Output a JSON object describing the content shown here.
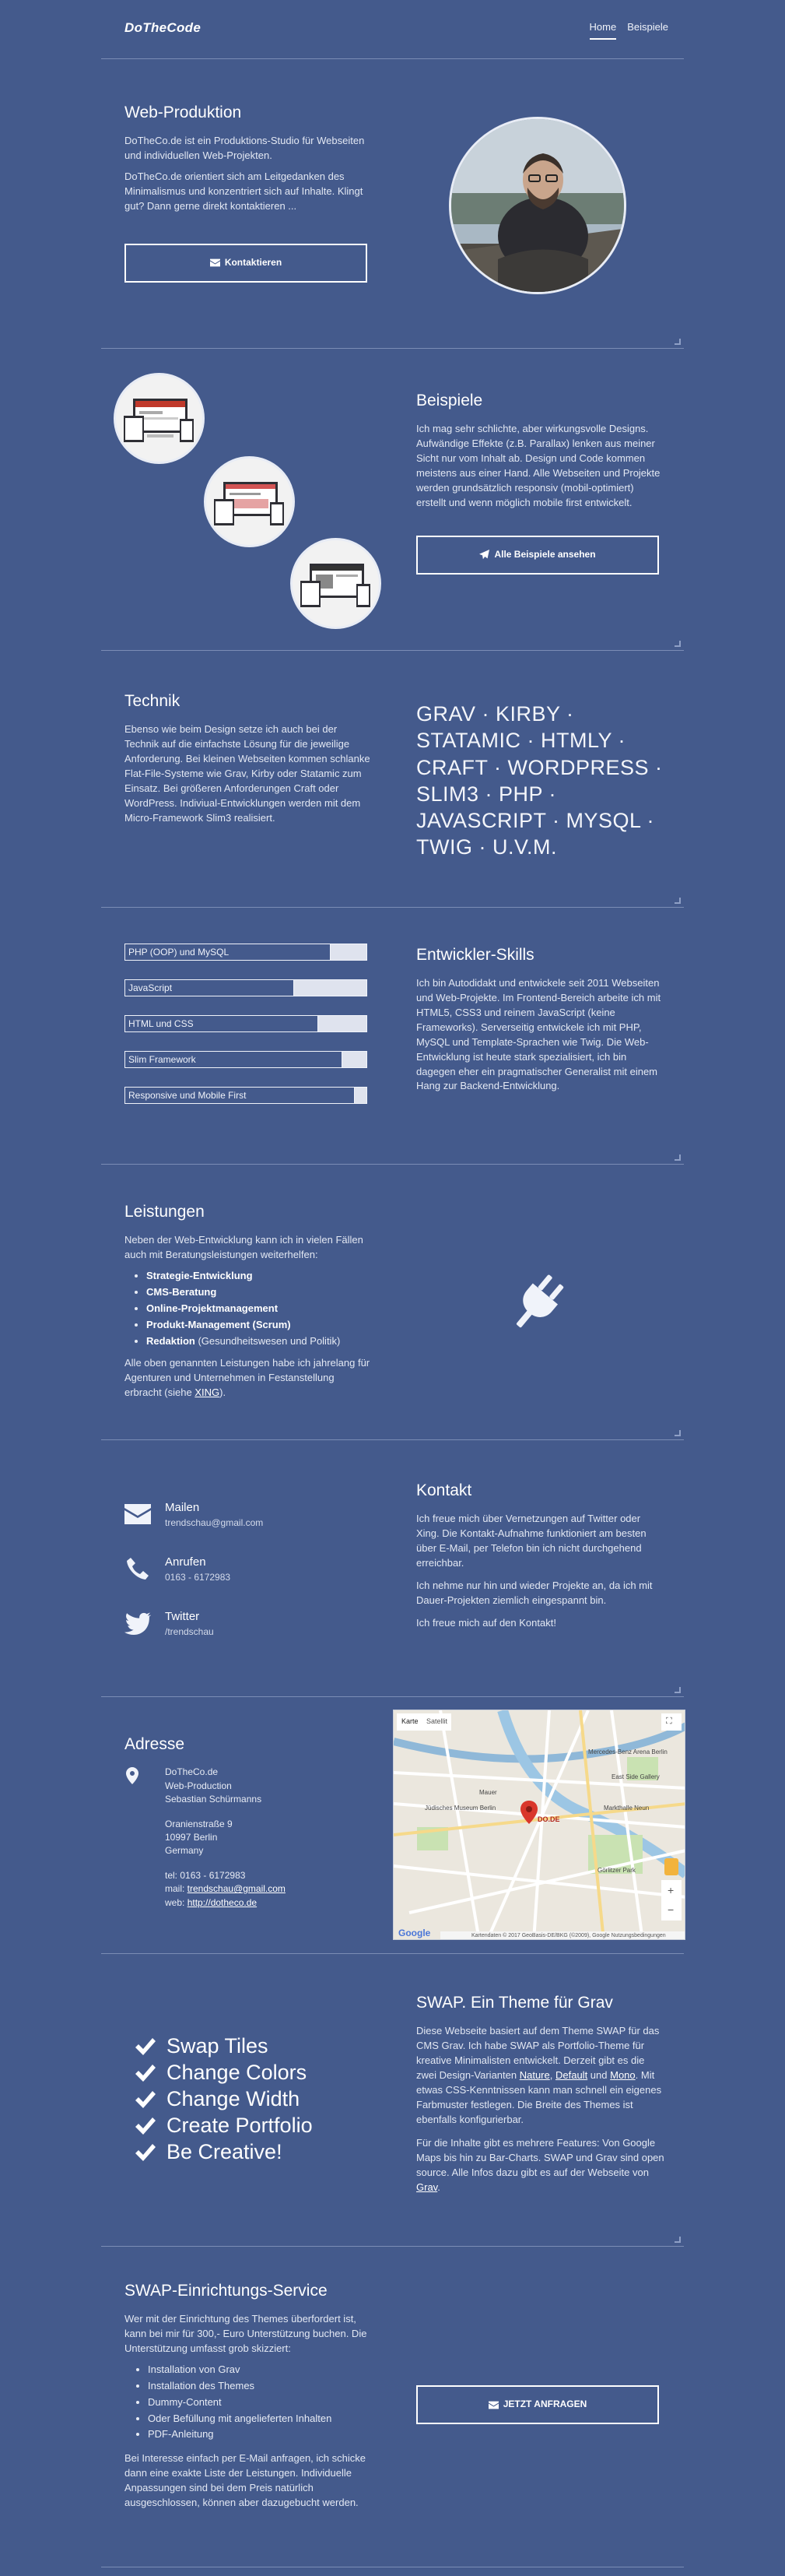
{
  "brand": "DoTheCode",
  "nav": [
    {
      "label": "Home",
      "active": true
    },
    {
      "label": "Beispiele",
      "active": false
    }
  ],
  "webprod": {
    "title": "Web-Produktion",
    "p1": "DoTheCo.de ist ein Produktions-Studio für Webseiten und individuellen Web-Projekten.",
    "p2": "DoTheCo.de orientiert sich am Leitgedanken des Minimalismus und konzentriert sich auf Inhalte. Klingt gut? Dann gerne direkt kontaktieren ...",
    "button": "Kontaktieren"
  },
  "beispiele": {
    "title": "Beispiele",
    "text": "Ich mag sehr schlichte, aber wirkungsvolle Designs. Aufwändige Effekte (z.B. Parallax) lenken aus meiner Sicht nur vom Inhalt ab. Design und Code kommen meistens aus einer Hand. Alle Webseiten und Projekte werden grundsätzlich responsiv (mobil-optimiert) erstellt und wenn möglich mobile first entwickelt.",
    "button": "Alle Beispiele ansehen"
  },
  "technik": {
    "title": "Technik",
    "text": "Ebenso wie beim Design setze ich auch bei der Technik auf die einfachste Lösung für die jeweilige Anforderung. Bei kleinen Webseiten kommen schlanke Flat-File-Systeme wie Grav, Kirby oder Statamic zum Einsatz. Bei größeren Anforderungen Craft oder WordPress. Indiviual-Entwicklungen werden mit dem Micro-Framework Slim3 realisiert.",
    "stack": "GRAV · KIRBY · STATAMIC · HTMLY · CRAFT · WORDPRESS · SLIM3 · PHP · JAVASCRIPT · MYSQL · TWIG · U.V.M."
  },
  "skills": {
    "title": "Entwickler-Skills",
    "text": "Ich bin Autodidakt und entwickele seit 2011 Webseiten und Web-Projekte. Im Frontend-Bereich arbeite ich mit HTML5, CSS3 und reinem JavaScript (keine Frameworks). Serverseitig entwickele ich mit PHP, MySQL und Template-Sprachen wie Twig. Die Web-Entwicklung ist heute stark spezialisiert, ich bin dagegen eher ein pragmatischer Generalist mit einem Hang zur Backend-Entwicklung.",
    "bars": [
      {
        "label": "PHP (OOP) und MySQL",
        "level": 0.85
      },
      {
        "label": "JavaScript",
        "level": 0.7
      },
      {
        "label": "HTML und CSS",
        "level": 0.8
      },
      {
        "label": "Slim Framework",
        "level": 0.9
      },
      {
        "label": "Responsive und Mobile First",
        "level": 0.95
      }
    ]
  },
  "leistungen": {
    "title": "Leistungen",
    "intro": "Neben der Web-Entwicklung kann ich in vielen Fällen auch mit Beratungsleistungen weiterhelfen:",
    "items": [
      {
        "bold": "Strategie-Entwicklung",
        "rest": ""
      },
      {
        "bold": "CMS-Beratung",
        "rest": ""
      },
      {
        "bold": "Online-Projektmanagement",
        "rest": ""
      },
      {
        "bold": "Produkt-Management (Scrum)",
        "rest": ""
      },
      {
        "bold": "Redaktion",
        "rest": " (Gesundheitswesen und Politik)"
      }
    ],
    "outro_pre": "Alle oben genannten Leistungen habe ich jahrelang für Agenturen und Unternehmen in Festanstellung erbracht (siehe ",
    "outro_link": "XING",
    "outro_post": ")."
  },
  "kontakt": {
    "title": "Kontakt",
    "mail_title": "Mailen",
    "mail_val": "trendschau@gmail.com",
    "phone_title": "Anrufen",
    "phone_val": "0163 - 6172983",
    "twitter_title": "Twitter",
    "twitter_val": "/trendschau",
    "p1": "Ich freue mich über Vernetzungen auf Twitter oder Xing. Die Kontakt-Aufnahme funktioniert am besten über E-Mail, per Telefon bin ich nicht durchgehend erreichbar.",
    "p2": "Ich nehme nur hin und wieder Projekte an, da ich mit Dauer-Projekten ziemlich eingespannt bin.",
    "p3": "Ich freue mich auf den Kontakt!"
  },
  "adresse": {
    "title": "Adresse",
    "lines": [
      "DoTheCo.de",
      "Web-Production",
      "Sebastian Schürmanns"
    ],
    "street": [
      "Oranienstraße 9",
      "10997 Berlin",
      "Germany"
    ],
    "tel": "tel: 0163 - 6172983",
    "mail_pre": "mail: ",
    "mail": "trendschau@gmail.com",
    "web_pre": "web: ",
    "web": "http://dotheco.de",
    "map": {
      "tab_map": "Karte",
      "tab_sat": "Satellit",
      "pin_label": "DO.DE",
      "labels": [
        "Mercedes-Benz Arena Berlin",
        "East Side Gallery",
        "Markthalle Neun",
        "Jüdisches Museum Berlin",
        "Görlitzer Park",
        "Mauer"
      ],
      "attribution": "Kartendaten © 2017 GeoBasis-DE/BKG (©2009), Google   Nutzungsbedingungen",
      "google": "Google"
    }
  },
  "swap": {
    "checks": [
      "Swap Tiles",
      "Change Colors",
      "Change Width",
      "Create Portfolio",
      "Be Creative!"
    ],
    "title": "SWAP. Ein Theme für Grav",
    "p1_a": "Diese Webseite basiert auf dem Theme SWAP für das CMS Grav. Ich habe SWAP als Portfolio-Theme für kreative Minimalisten entwickelt. Derzeit gibt es die zwei Design-Varianten ",
    "p1_l1": "Nature",
    "p1_b": ", ",
    "p1_l2": "Default",
    "p1_c": " und ",
    "p1_l3": "Mono",
    "p1_d": ". Mit etwas CSS-Kenntnissen kann man schnell ein eigenes Farbmuster festlegen. Die Breite des Themes ist ebenfalls konfigurierbar.",
    "p2_a": "Für die Inhalte gibt es mehrere Features: Von Google Maps bis hin zu Bar-Charts. SWAP und Grav sind open source. Alle Infos dazu gibt es auf der Webseite von ",
    "p2_l": "Grav",
    "p2_b": "."
  },
  "service": {
    "title": "SWAP-Einrichtungs-Service",
    "p1": "Wer mit der Einrichtung des Themes überfordert ist, kann bei mir für 300,- Euro Unterstützung buchen. Die Unterstützung umfasst grob skizziert:",
    "items": [
      "Installation von Grav",
      "Installation des Themes",
      "Dummy-Content",
      "Oder Befüllung mit angelieferten Inhalten",
      "PDF-Anleitung"
    ],
    "p2": "Bei Interesse einfach per E-Mail anfragen, ich schicke dann eine exakte Liste der Leistungen. Individuelle Anpassungen sind bei dem Preis natürlich ausgeschlossen, können aber dazugebucht werden.",
    "button": "JETZT ANFRAGEN"
  }
}
